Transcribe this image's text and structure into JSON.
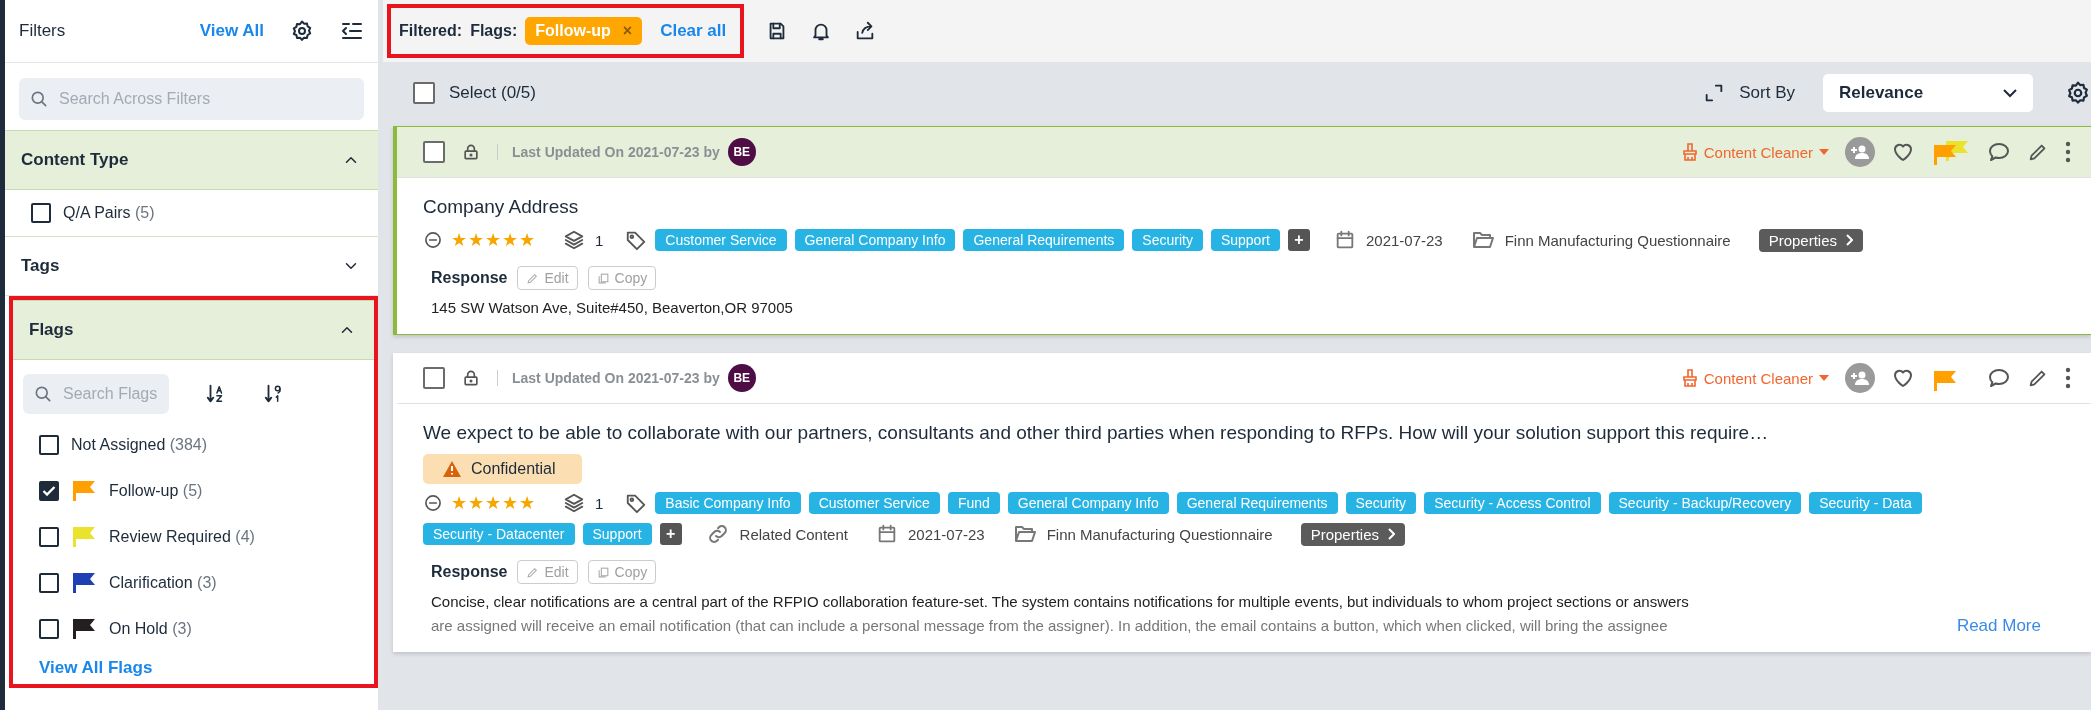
{
  "sidebar": {
    "title": "Filters",
    "view_all": "View All",
    "search_placeholder": "Search Across Filters",
    "sections": [
      {
        "title": "Content Type",
        "expanded": true,
        "highlighted": false,
        "options": [
          {
            "label": "Q/A Pairs",
            "count": "(5)",
            "checked": false
          }
        ]
      },
      {
        "title": "Tags",
        "expanded": false,
        "highlighted": false
      },
      {
        "title": "Flags",
        "expanded": true,
        "highlighted": true,
        "search_placeholder": "Search Flags",
        "options": [
          {
            "label": "Not Assigned",
            "count": "(384)",
            "checked": false
          },
          {
            "label": "Follow-up",
            "count": "(5)",
            "checked": true,
            "color": "#ffa000"
          },
          {
            "label": "Review Required",
            "count": "(4)",
            "checked": false,
            "color": "#ebe22e"
          },
          {
            "label": "Clarification",
            "count": "(3)",
            "checked": false,
            "color": "#1f3fb5"
          },
          {
            "label": "On Hold",
            "count": "(3)",
            "checked": false,
            "color": "#231f1f"
          }
        ],
        "footer_link": "View All Flags"
      }
    ]
  },
  "filter_bar": {
    "label": "Filtered:",
    "group": "Flags:",
    "chips": [
      {
        "label": "Follow-up",
        "remove": "×"
      }
    ],
    "clear": "Clear all"
  },
  "list_bar": {
    "checked": false,
    "select_label": "Select (0/5)",
    "sort_label": "Sort By",
    "sort_value": "Relevance"
  },
  "cards": [
    {
      "highlighted": true,
      "checked": false,
      "updated": "Last Updated On 2021-07-23 by",
      "avatar": "BE",
      "owner": "Content Cleaner",
      "flags": [
        {
          "color": "#ffa000"
        },
        {
          "color": "#ebe22e"
        }
      ],
      "title": "Company Address",
      "stars": 5,
      "versions": "1",
      "tags": [
        "Customer Service",
        "General Company Info",
        "General Requirements",
        "Security",
        "Support"
      ],
      "more": "+",
      "date": "2021-07-23",
      "project": "Finn Manufacturing Questionnaire",
      "properties": "Properties",
      "response_label": "Response",
      "edit": "Edit",
      "copy": "Copy",
      "response_lines": [
        "145 SW Watson Ave, Suite#450, Beaverton,OR 97005"
      ]
    },
    {
      "highlighted": false,
      "checked": false,
      "updated": "Last Updated On 2021-07-23 by",
      "avatar": "BE",
      "owner": "Content Cleaner",
      "flags": [
        {
          "color": "#ffa000"
        }
      ],
      "title": "We expect to be able to collaborate with our partners, consultants and other third parties when responding to RFPs. How will your solution support this require…",
      "notice": "Confidential",
      "stars": 5,
      "versions": "1",
      "tags": [
        "Basic Company Info",
        "Customer Service",
        "Fund",
        "General Company Info",
        "General Requirements",
        "Security",
        "Security - Access Control",
        "Security - Backup/Recovery",
        "Security - Data",
        "Security - Datacenter",
        "Support"
      ],
      "more": "+",
      "related": "Related Content",
      "date": "2021-07-23",
      "project": "Finn Manufacturing Questionnaire",
      "properties": "Properties",
      "response_label": "Response",
      "edit": "Edit",
      "copy": "Copy",
      "response_lines": [
        "Concise, clear notifications are a central part of the RFPIO collaboration feature-set. The system contains notifications for multiple events, but individuals to whom project sections or answers",
        "are assigned will receive an email notification (that can include a personal message from the assigner). In addition, the email contains a button, which when clicked, will bring the assignee"
      ],
      "read_more": "Read More"
    }
  ]
}
